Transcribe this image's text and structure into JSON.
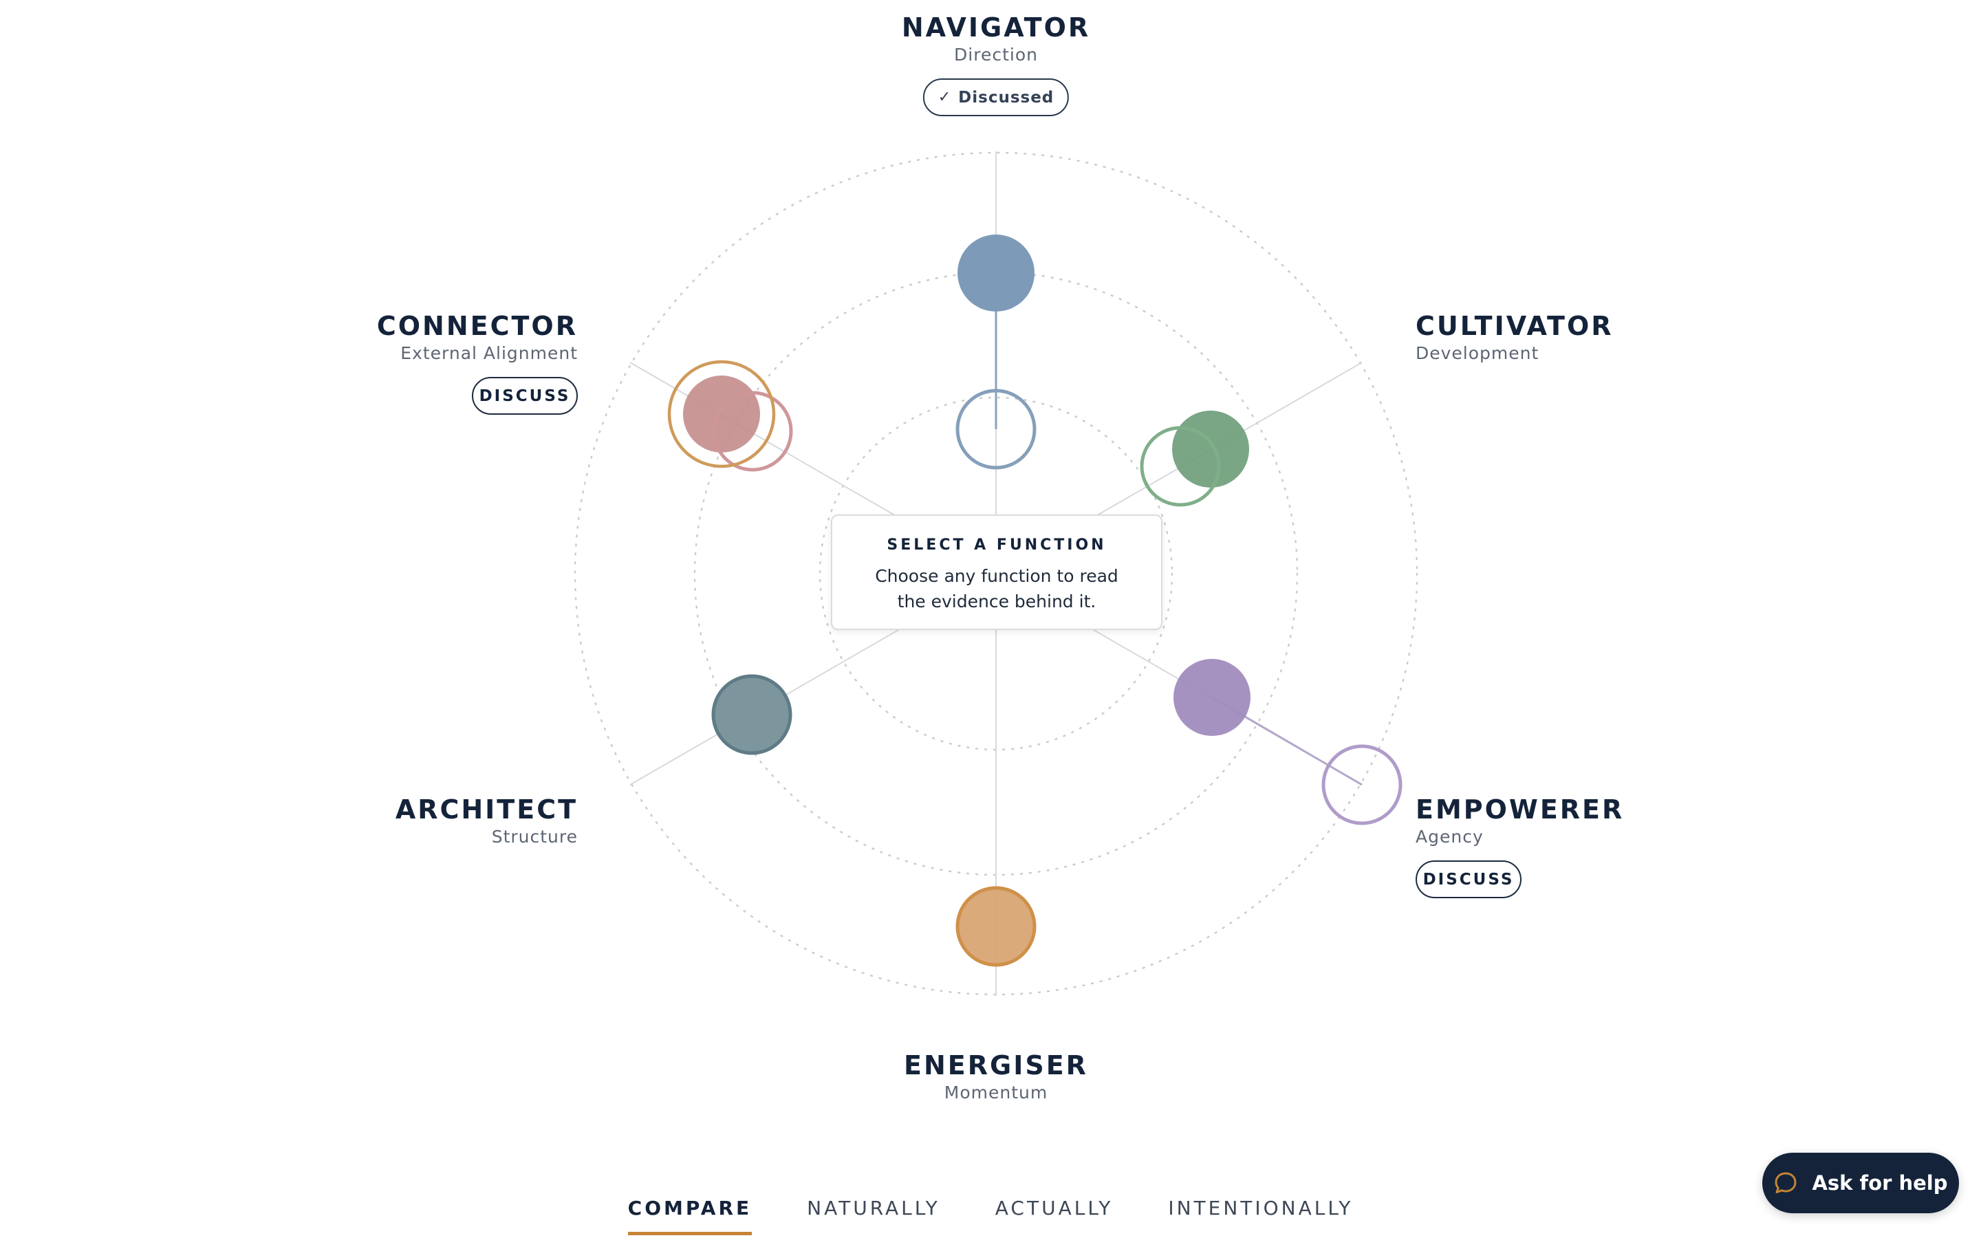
{
  "functions": {
    "navigator": {
      "name": "NAVIGATOR",
      "subtitle": "Direction",
      "status_label": "Discussed"
    },
    "cultivator": {
      "name": "CULTIVATOR",
      "subtitle": "Development"
    },
    "empowerer": {
      "name": "EMPOWERER",
      "subtitle": "Agency",
      "action_label": "DISCUSS"
    },
    "energiser": {
      "name": "ENERGISER",
      "subtitle": "Momentum"
    },
    "architect": {
      "name": "ARCHITECT",
      "subtitle": "Structure"
    },
    "connector": {
      "name": "CONNECTOR",
      "subtitle": "External Alignment",
      "action_label": "DISCUSS"
    }
  },
  "center_card": {
    "title": "SELECT A FUNCTION",
    "body": "Choose any function to read the evidence behind it."
  },
  "tabs": [
    {
      "label": "COMPARE",
      "active": true
    },
    {
      "label": "NATURALLY",
      "active": false
    },
    {
      "label": "ACTUALLY",
      "active": false
    },
    {
      "label": "INTENTIONALLY",
      "active": false
    }
  ],
  "help_button": {
    "label": "Ask for help",
    "icon": "chat-bubble-icon"
  },
  "colors": {
    "navigator": "#7d9bb8",
    "cultivator": "#6f9e7b",
    "empowerer": "#a18cbd",
    "energiser": "#d6a16c",
    "architect": "#7d959d",
    "connector": "#c48c8c",
    "accent": "#c58436",
    "ink": "#14233a"
  }
}
